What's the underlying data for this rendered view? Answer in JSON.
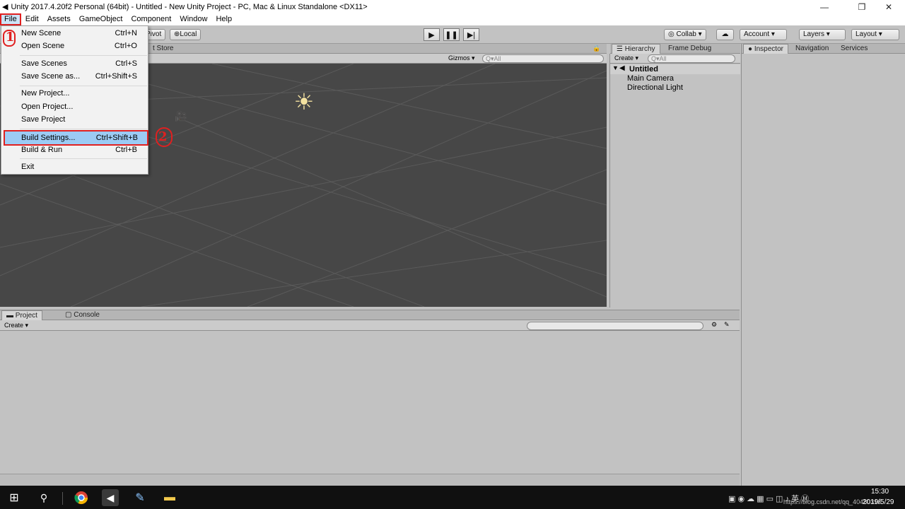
{
  "window": {
    "title": "Unity 2017.4.20f2 Personal (64bit) - Untitled - New Unity Project - PC, Mac & Linux Standalone <DX11>",
    "minimize": "—",
    "maximize": "❐",
    "close": "✕"
  },
  "menubar": [
    "File",
    "Edit",
    "Assets",
    "GameObject",
    "Component",
    "Window",
    "Help"
  ],
  "toolbar": {
    "pivot": "Pivot",
    "local": "Local",
    "collab": "Collab ▾",
    "account": "Account ▾",
    "layers": "Layers ▾",
    "layout": "Layout ▾"
  },
  "file_menu": {
    "items": [
      {
        "label": "New Scene",
        "shortcut": "Ctrl+N"
      },
      {
        "label": "Open Scene",
        "shortcut": "Ctrl+O"
      },
      {
        "label": "Save Scenes",
        "shortcut": "Ctrl+S"
      },
      {
        "label": "Save Scene as...",
        "shortcut": "Ctrl+Shift+S"
      },
      {
        "label": "New Project...",
        "shortcut": ""
      },
      {
        "label": "Open Project...",
        "shortcut": ""
      },
      {
        "label": "Save Project",
        "shortcut": ""
      },
      {
        "label": "Build Settings...",
        "shortcut": "Ctrl+Shift+B"
      },
      {
        "label": "Build & Run",
        "shortcut": "Ctrl+B"
      },
      {
        "label": "Exit",
        "shortcut": ""
      }
    ]
  },
  "scene": {
    "tab_partial": "t Store",
    "gizmos": "Gizmos ▾",
    "search": "Q▾All"
  },
  "hierarchy": {
    "tabs": [
      "Hierarchy",
      "Frame Debug"
    ],
    "create": "Create ▾",
    "search": "Q▾All",
    "scene_name": "Untitled",
    "objects": [
      "Main Camera",
      "Directional Light"
    ]
  },
  "inspector": {
    "tabs": [
      "Inspector",
      "Navigation",
      "Services"
    ]
  },
  "project": {
    "tabs": [
      "Project",
      "Console"
    ],
    "create": "Create ▾"
  },
  "annotations": {
    "one": "1",
    "two": "2"
  },
  "taskbar": {
    "time": "15:30",
    "date": "2019/5/29",
    "watermark": "https://blog.csdn.net/qq_40480316"
  }
}
